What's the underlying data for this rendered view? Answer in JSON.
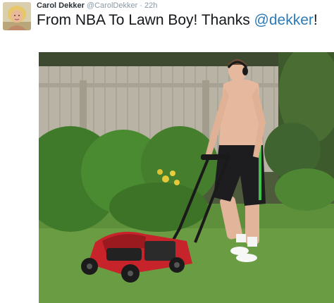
{
  "tweet": {
    "author_name": "Carol Dekker",
    "author_handle": "@CarolDekker",
    "separator": "·",
    "timestamp": "22h",
    "text_before_mention": "From NBA To Lawn Boy! Thanks ",
    "mention": "@dekker",
    "text_after_mention": "!"
  },
  "icons": {
    "avatar": "profile-photo",
    "media": "photo-man-mowing-lawn"
  },
  "colors": {
    "link": "#2b7bb9",
    "name": "#292f33",
    "meta": "#8899a6",
    "text": "#14171a"
  }
}
